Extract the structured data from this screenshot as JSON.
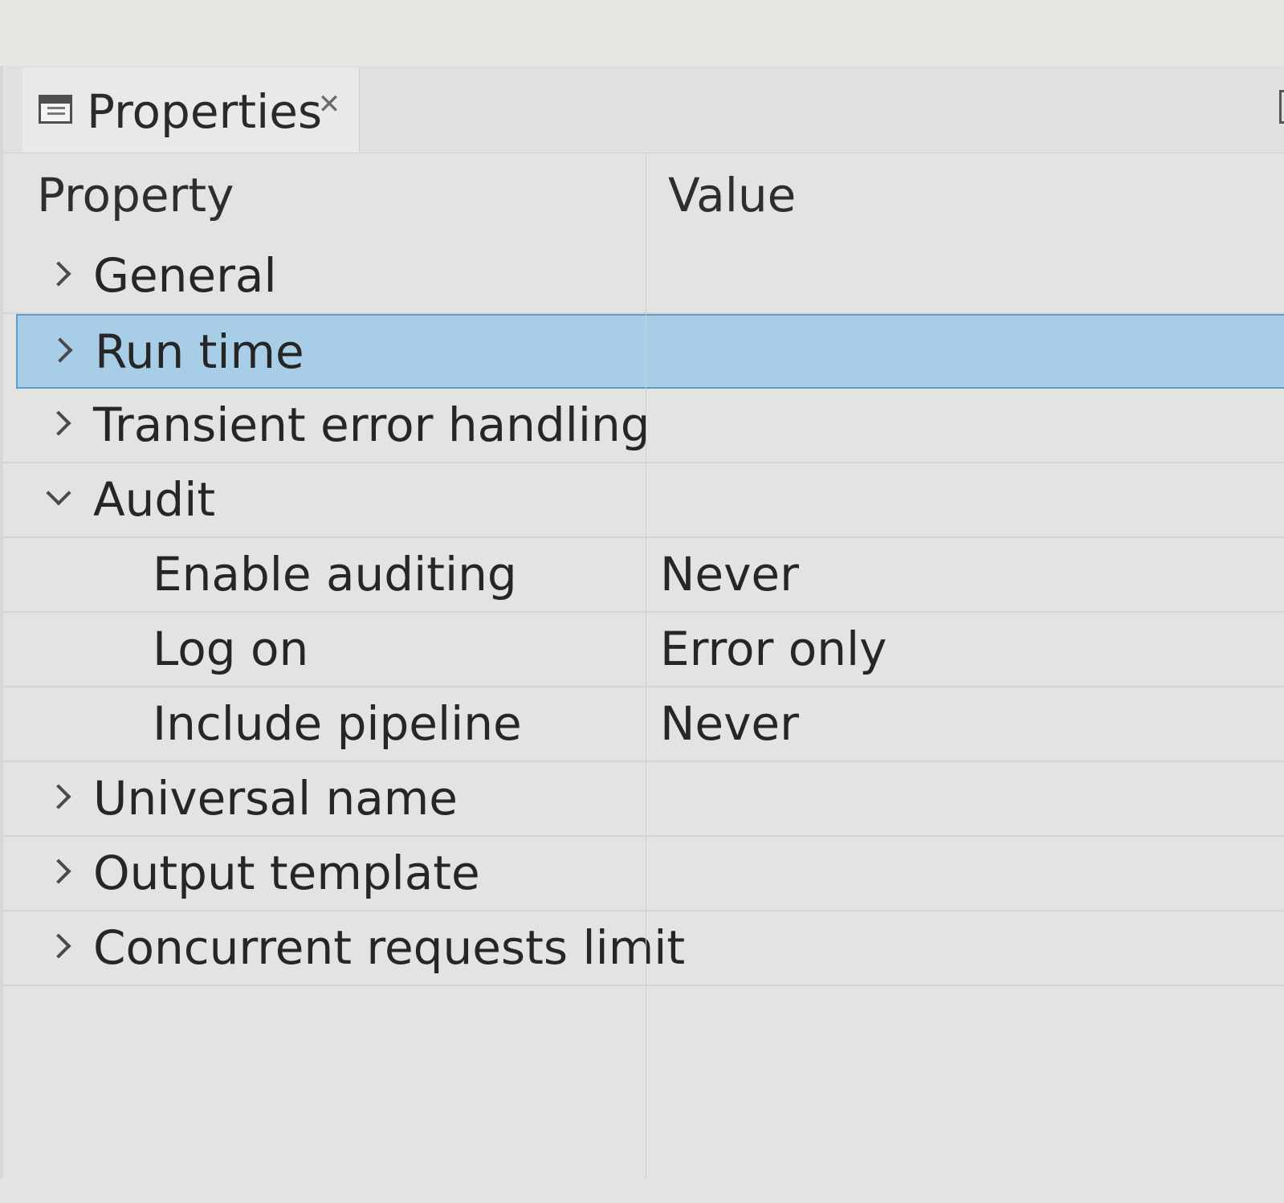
{
  "view": {
    "tab_title": "Properties",
    "tab_close_icon": "close-icon",
    "tab_icon": "properties-view-icon"
  },
  "table": {
    "columns": [
      "Property",
      "Value"
    ],
    "rows": [
      {
        "label": "General",
        "value": "",
        "level": 0,
        "state": "collapsed",
        "selected": false
      },
      {
        "label": "Run time",
        "value": "",
        "level": 0,
        "state": "collapsed",
        "selected": true
      },
      {
        "label": "Transient error handling",
        "value": "",
        "level": 0,
        "state": "collapsed",
        "selected": false
      },
      {
        "label": "Audit",
        "value": "",
        "level": 0,
        "state": "expanded",
        "selected": false
      },
      {
        "label": "Enable auditing",
        "value": "Never",
        "level": 1,
        "state": "leaf",
        "selected": false
      },
      {
        "label": "Log on",
        "value": "Error only",
        "level": 1,
        "state": "leaf",
        "selected": false
      },
      {
        "label": "Include pipeline",
        "value": "Never",
        "level": 1,
        "state": "leaf",
        "selected": false
      },
      {
        "label": "Universal name",
        "value": "",
        "level": 0,
        "state": "collapsed",
        "selected": false
      },
      {
        "label": "Output template",
        "value": "",
        "level": 0,
        "state": "collapsed",
        "selected": false
      },
      {
        "label": "Concurrent requests limit",
        "value": "",
        "level": 0,
        "state": "collapsed",
        "selected": false
      }
    ]
  },
  "colors": {
    "selection_fill": "#a8cde6",
    "selection_border": "#5b9cc9",
    "background": "#e3e4e1"
  }
}
